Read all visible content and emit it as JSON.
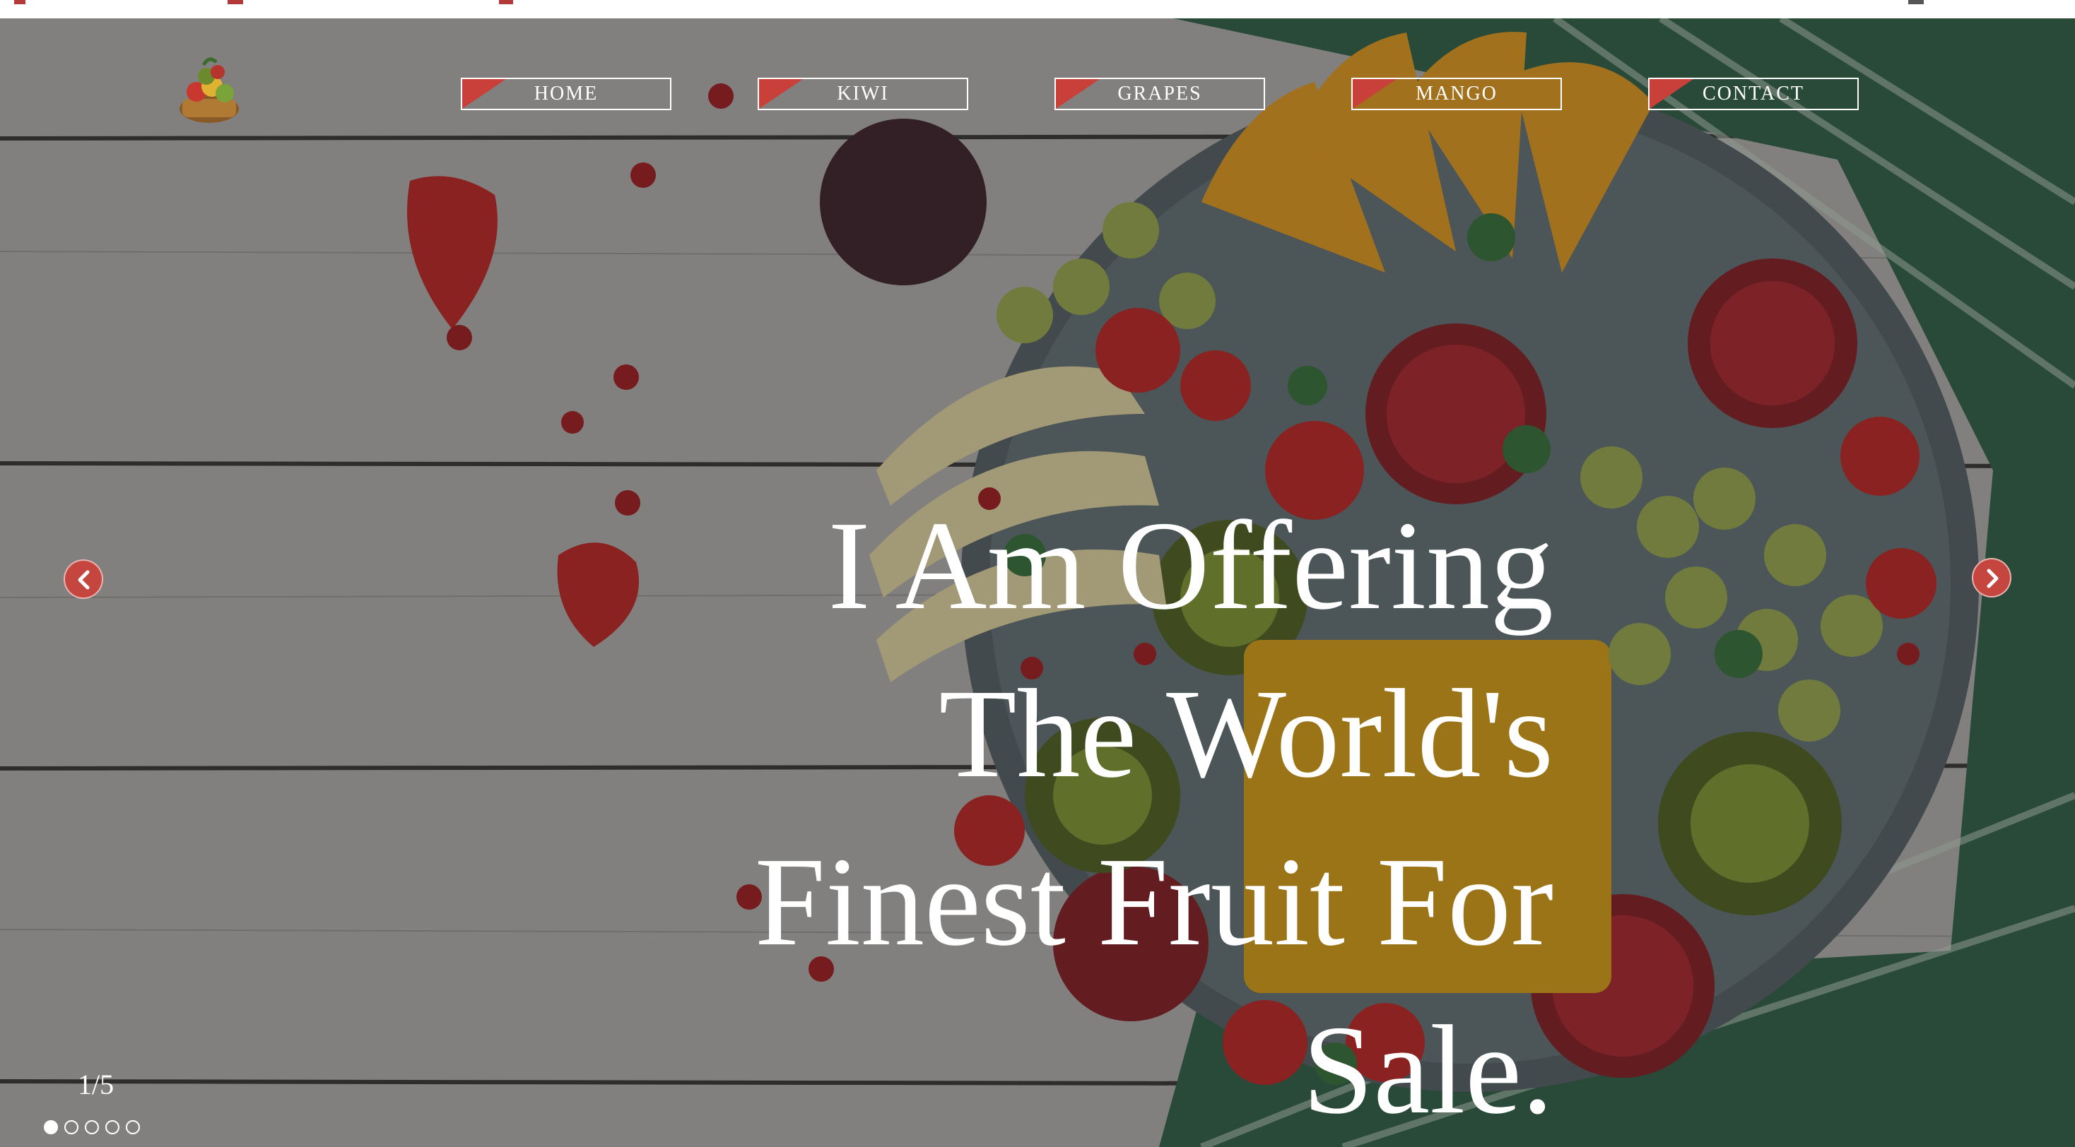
{
  "colors": {
    "accent": "#c9403b",
    "text": "#ffffff"
  },
  "nav": {
    "logo_icon": "fruit-basket-icon",
    "items": [
      {
        "label": "HOME"
      },
      {
        "label": "KIWI"
      },
      {
        "label": "GRAPES"
      },
      {
        "label": "MANGO"
      },
      {
        "label": "CONTACT"
      }
    ]
  },
  "hero": {
    "headline_lines": [
      "I Am Offering",
      "The World's",
      "Finest Fruit For",
      "Sale."
    ],
    "prev_icon": "chevron-left-icon",
    "next_icon": "chevron-right-icon",
    "counter": "1/5",
    "slide_count": 5,
    "active_slide": 1
  }
}
